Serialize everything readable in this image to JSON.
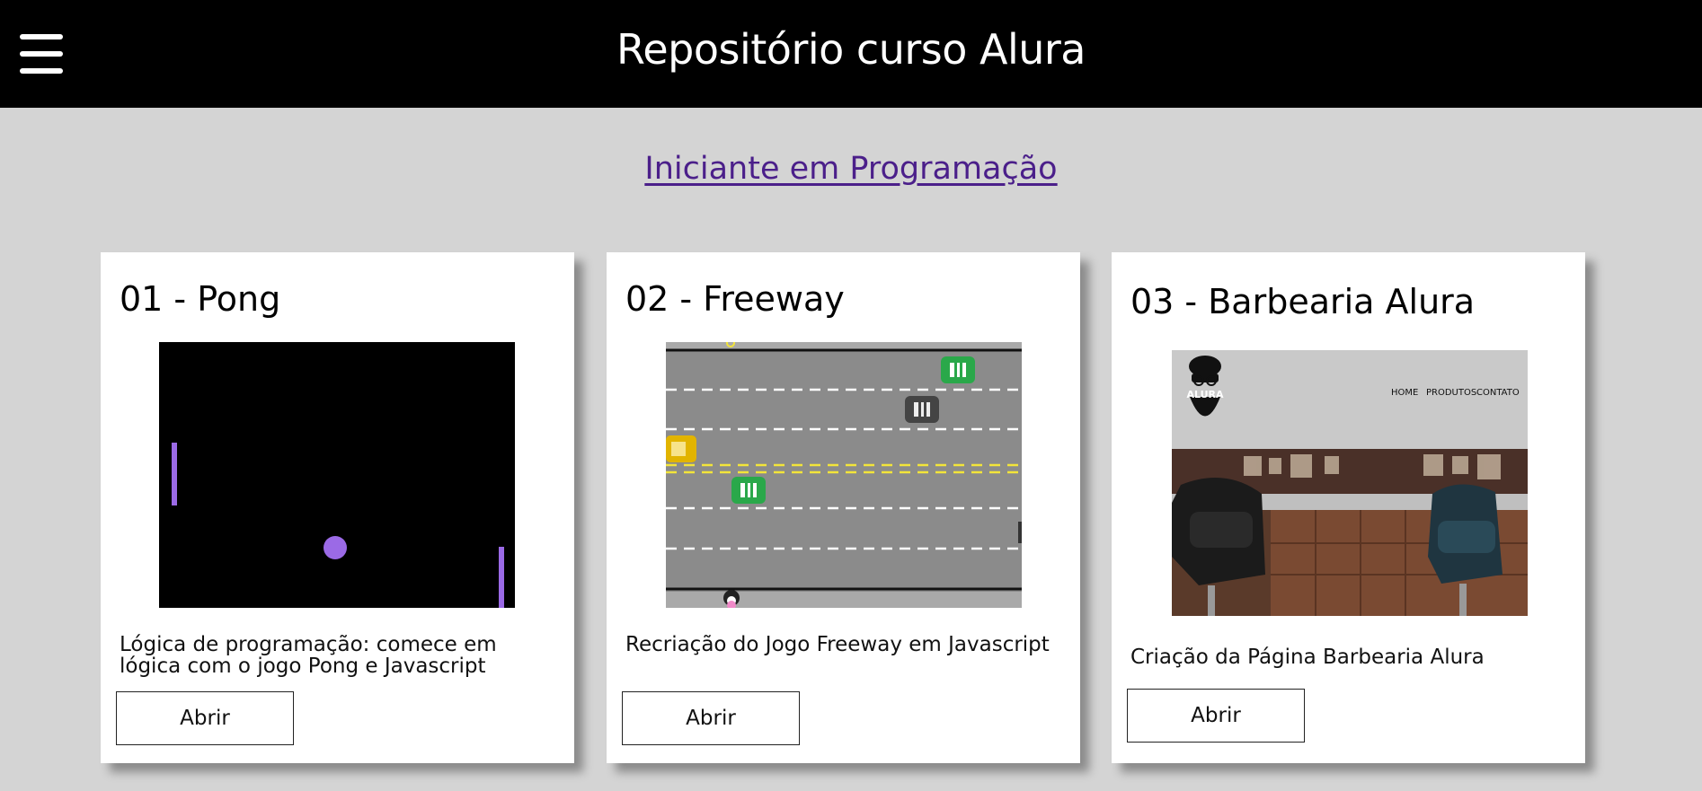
{
  "header": {
    "title": "Repositório curso Alura",
    "menu_icon": "hamburger-menu-icon"
  },
  "section": {
    "link_text": "Iniciante em Programação"
  },
  "colors": {
    "header_bg": "#000000",
    "page_bg": "#d4d4d4",
    "link": "#4b1f8a",
    "pong_accent": "#9b6ae6"
  },
  "cards": [
    {
      "title": "01 - Pong",
      "description": "Lógica de programação: comece em lógica com o jogo Pong e Javascript",
      "button": "Abrir"
    },
    {
      "title": "02 - Freeway",
      "description": "Recriação do Jogo Freeway em Javascript",
      "button": "Abrir"
    },
    {
      "title": "03 - Barbearia Alura",
      "description": "Criação da Página Barbearia Alura",
      "button": "Abrir",
      "preview": {
        "logo_text": "ALURA",
        "nav": [
          "HOME",
          "PRODUTOS",
          "CONTATO"
        ]
      }
    }
  ]
}
